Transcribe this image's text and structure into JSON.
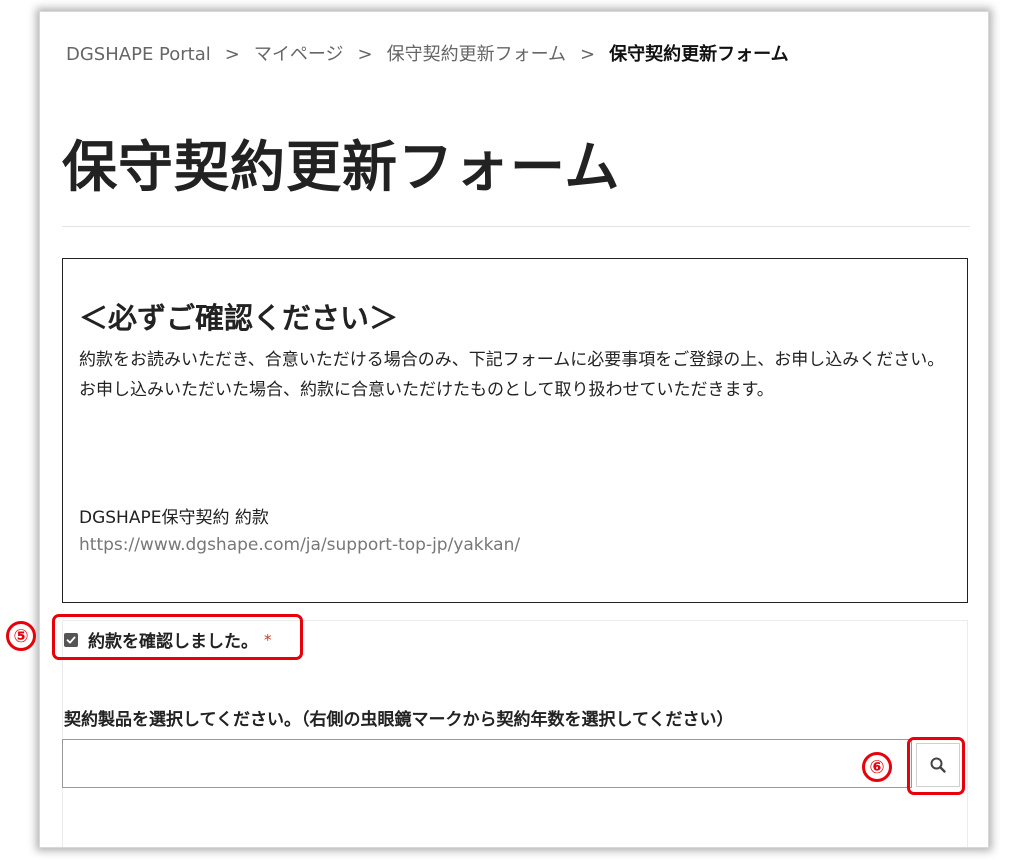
{
  "breadcrumb": {
    "items": [
      "DGSHAPE Portal",
      "マイページ",
      "保守契約更新フォーム"
    ],
    "current": "保守契約更新フォーム",
    "separator": ">"
  },
  "page": {
    "title": "保守契約更新フォーム"
  },
  "notice": {
    "heading": "＜必ずご確認ください＞",
    "paragraph1": "約款をお読みいただき、合意いただける場合のみ、下記フォームに必要事項をご登録の上、お申し込みください。",
    "paragraph2": "お申し込みいただいた場合、約款に合意いただけたものとして取り扱わせていただきます。",
    "contract_name": "DGSHAPE保守契約 約款",
    "contract_url": "https://www.dgshape.com/ja/support-top-jp/yakkan/"
  },
  "form": {
    "agree_label": "約款を確認しました。",
    "agree_checked": true,
    "required_mark": "*",
    "product_label": "契約製品を選択してください。（右側の虫眼鏡マークから契約年数を選択してください）",
    "product_value": ""
  },
  "annotations": {
    "step5": "⑤",
    "step6": "⑥",
    "highlight_color": "#e8000b"
  },
  "icons": {
    "lookup": "search-icon",
    "checkbox": "check-icon"
  }
}
